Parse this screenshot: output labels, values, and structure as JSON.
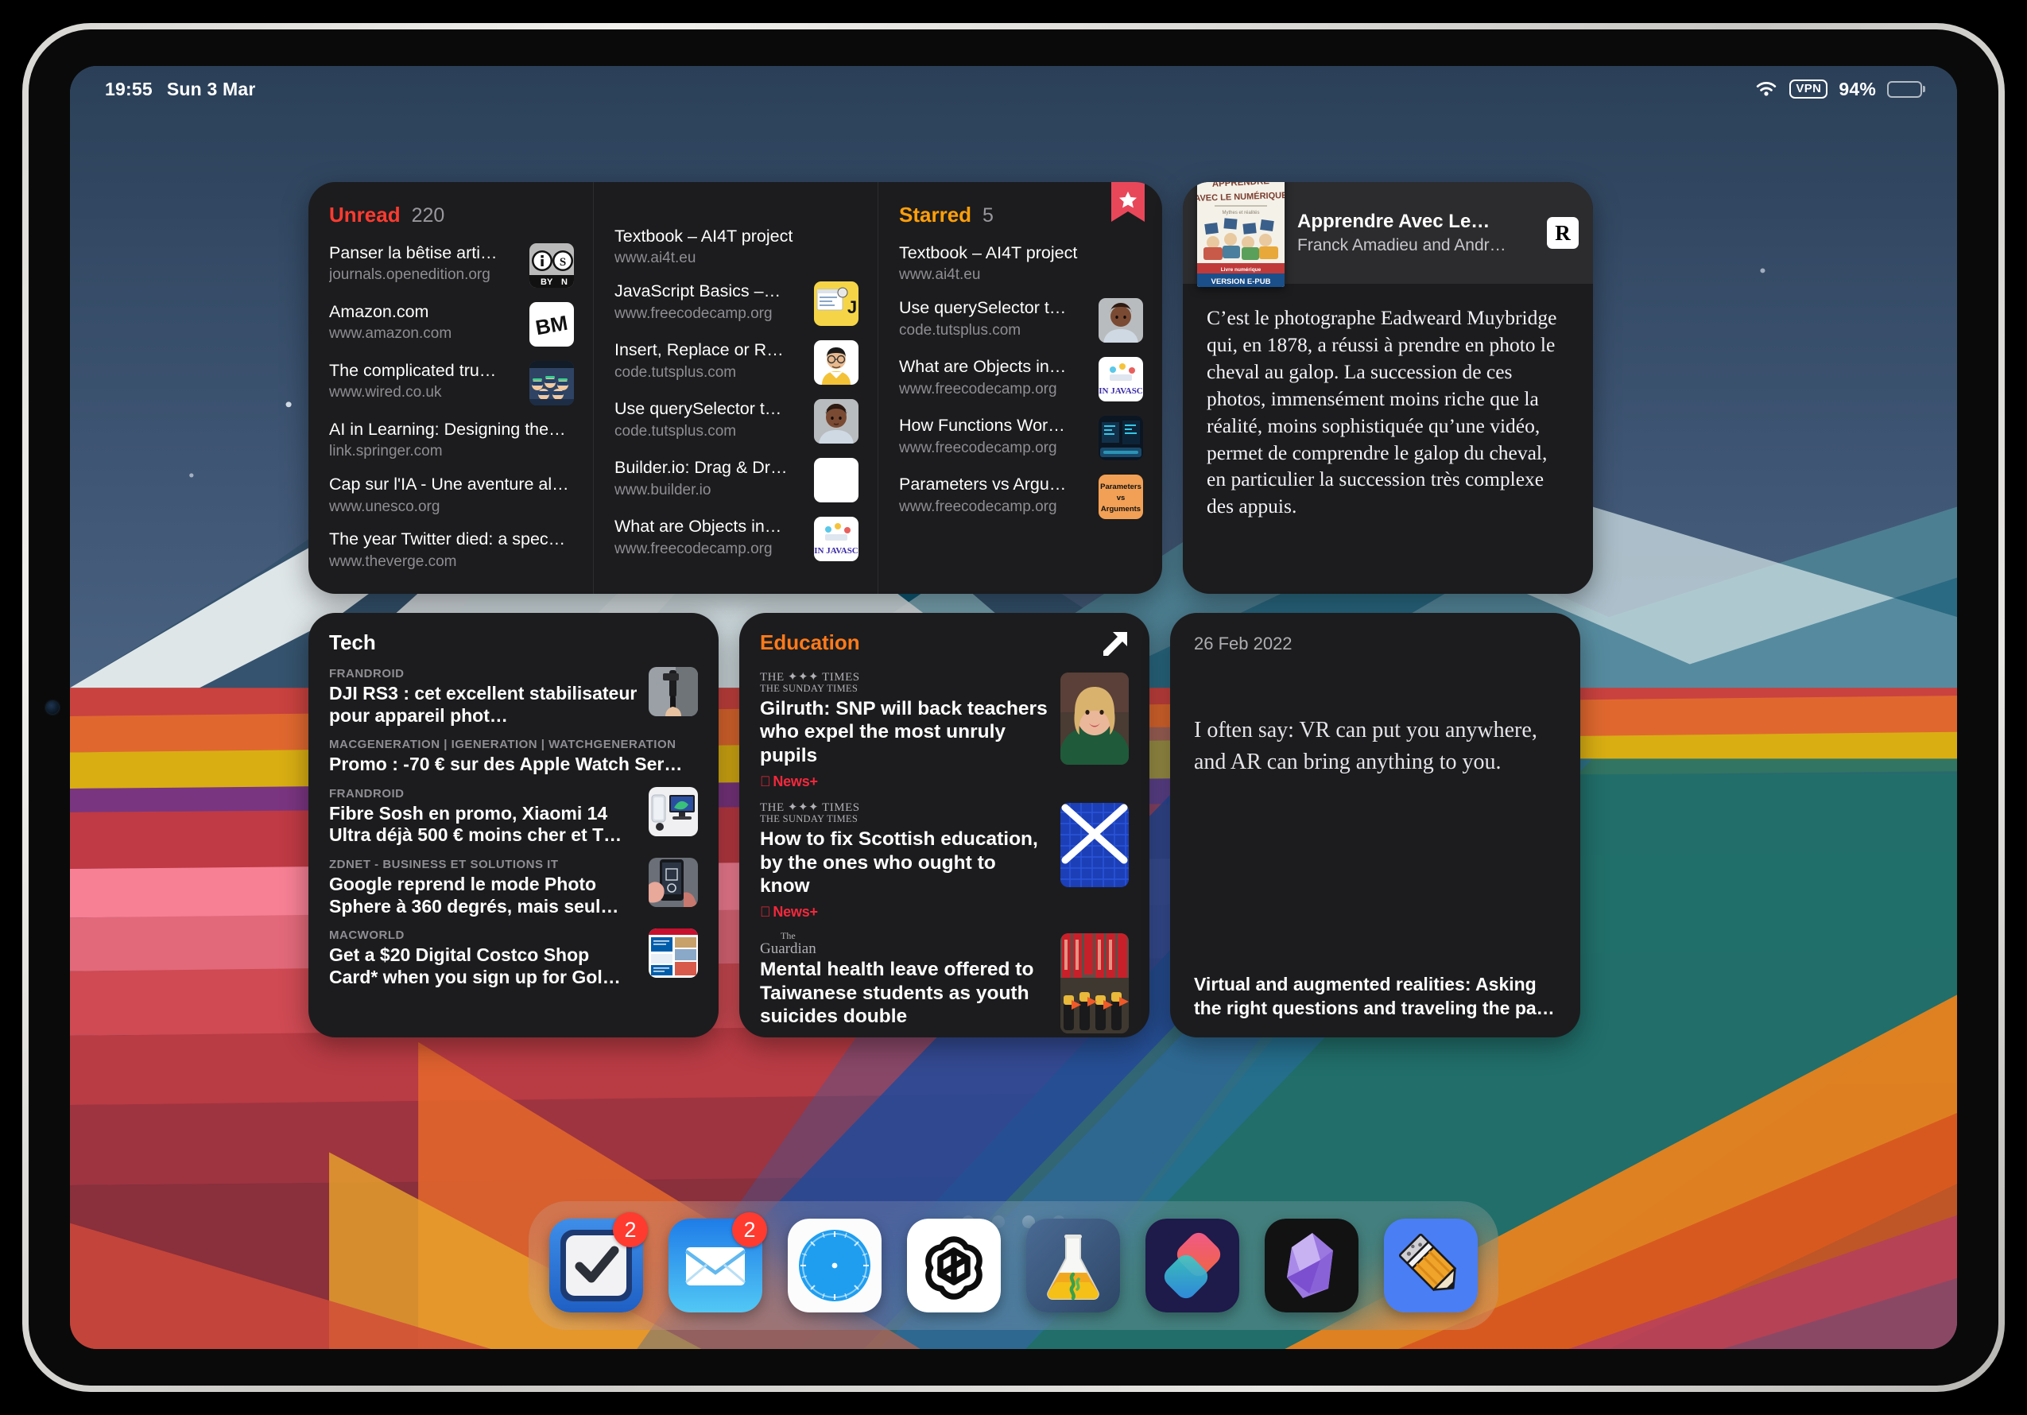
{
  "status_bar": {
    "time": "19:55",
    "date": "Sun 3 Mar",
    "wifi_icon": "wifi-icon",
    "vpn_label": "VPN",
    "battery_percent": "94%",
    "battery_level": 94
  },
  "unread_widget": {
    "title": "Unread",
    "count": "220",
    "items": [
      {
        "title": "Panser la bêtise arti…",
        "url": "journals.openedition.org",
        "thumb": "cc-by-nc-license-thumb"
      },
      {
        "title": "Amazon.com",
        "url": "www.amazon.com",
        "thumb": "ibm-logo-thumb"
      },
      {
        "title": "The complicated tru…",
        "url": "www.wired.co.uk",
        "thumb": "vr-crowd-illustration-thumb"
      },
      {
        "title": "AI in Learning: Designing the…",
        "url": "link.springer.com",
        "thumb": ""
      },
      {
        "title": "Cap sur l'IA - Une aventure al…",
        "url": "www.unesco.org",
        "thumb": ""
      },
      {
        "title": "The year Twitter died: a spec…",
        "url": "www.theverge.com",
        "thumb": ""
      }
    ]
  },
  "unread_widget_mid": {
    "items": [
      {
        "title": "Textbook – AI4T project",
        "url": "www.ai4t.eu",
        "thumb": ""
      },
      {
        "title": "JavaScript Basics –…",
        "url": "www.freecodecamp.org",
        "thumb": "js-yellow-thumb"
      },
      {
        "title": "Insert, Replace or R…",
        "url": "code.tutsplus.com",
        "thumb": "avatar-man-yellow-thumb"
      },
      {
        "title": "Use querySelector t…",
        "url": "code.tutsplus.com",
        "thumb": "avatar-woman-thumb"
      },
      {
        "title": "Builder.io: Drag & Dr…",
        "url": "www.builder.io",
        "thumb": "white-blank-thumb"
      },
      {
        "title": "What are Objects in…",
        "url": "www.freecodecamp.org",
        "thumb": "objects-in-javascript-thumb"
      }
    ]
  },
  "starred_widget": {
    "title": "Starred",
    "count": "5",
    "bookmark_icon": "starred-bookmark-icon",
    "items": [
      {
        "title": "Textbook – AI4T project",
        "url": "www.ai4t.eu",
        "thumb": ""
      },
      {
        "title": "Use querySelector t…",
        "url": "code.tutsplus.com",
        "thumb": "avatar-woman-thumb"
      },
      {
        "title": "What are Objects in…",
        "url": "www.freecodecamp.org",
        "thumb": "objects-in-javascript-thumb"
      },
      {
        "title": "How Functions Wor…",
        "url": "www.freecodecamp.org",
        "thumb": "code-screen-thumb"
      },
      {
        "title": "Parameters vs Argu…",
        "url": "www.freecodecamp.org",
        "thumb": "parameters-vs-arguments-thumb"
      }
    ]
  },
  "book_widget": {
    "app_logo": "readwise-logo",
    "app_logo_letter": "R",
    "cover_line1": "APPRENDRE",
    "cover_line2": "AVEC LE NUMÉRIQUE",
    "cover_sub": "Mythes et réalités",
    "cover_band1": "Livre numérique",
    "cover_band2": "VERSION E-PUB",
    "title": "Apprendre Avec Le…",
    "author": "Franck Amadieu and Andr…",
    "highlight": "C’est le photographe Eadweard Muybridge qui, en 1878, a réussi à prendre en photo le cheval au galop. La succession de ces photos, immensément moins riche que la réalité, moins sophistiquée qu’une vidéo, permet de comprendre le galop du cheval, en particulier la succession très complexe des appuis."
  },
  "tech_widget": {
    "title": "Tech",
    "items": [
      {
        "source": "FRANDROID",
        "title": "DJI RS3 : cet excellent stabilisateur pour appareil phot…",
        "thumb": "gimbal-photo-thumb"
      },
      {
        "source": "MACGENERATION | IGENERATION | WATCHGENERATION",
        "title": "Promo : -70 € sur des Apple Watch Ser…",
        "thumb": ""
      },
      {
        "source": "FRANDROID",
        "title": "Fibre Sosh en promo, Xiaomi 14 Ultra déjà 500 € moins cher et T…",
        "thumb": "phone-tv-thumb"
      },
      {
        "source": "ZDNET - BUSINESS ET SOLUTIONS IT",
        "title": "Google reprend le mode Photo Sphere à 360 degrés, mais seul…",
        "thumb": "hand-phone-camera-thumb"
      },
      {
        "source": "MACWORLD",
        "title": "Get a $20 Digital Costco Shop Card* when you sign up for Gol…",
        "thumb": "costco-offer-thumb"
      }
    ]
  },
  "education_widget": {
    "title": "Education",
    "app_icon": "apple-news-icon",
    "items": [
      {
        "publisher": "the-times-logo",
        "publisher_line1": "THE ✦✦✦ TIMES",
        "publisher_line2": "THE SUNDAY TIMES",
        "title": "Gilruth: SNP will back teachers who expel the most unruly pupils",
        "badge": "News+",
        "thumb": "woman-politician-thumb"
      },
      {
        "publisher": "the-times-logo",
        "publisher_line1": "THE ✦✦✦ TIMES",
        "publisher_line2": "THE SUNDAY TIMES",
        "title": "How to fix Scottish education, by the ones who ought to know",
        "badge": "News+",
        "thumb": "scotland-flag-thumb"
      },
      {
        "publisher": "the-guardian-logo",
        "publisher_line1": "The",
        "publisher_line2": "Guardian",
        "title": "Mental health leave offered to Taiwanese students as youth suicides double",
        "badge": "",
        "thumb": "taiwan-students-thumb"
      }
    ]
  },
  "quote_widget": {
    "date": "26 Feb 2022",
    "quote": "I often say: VR can put you anywhere, and AR can bring anything to you.",
    "caption": "Virtual and augmented realities: Asking the right questions and traveling the pa…"
  },
  "page_dots": {
    "total": 4,
    "active_index": 2
  },
  "dock": {
    "apps": [
      {
        "name": "Things",
        "icon": "things-checkmark-icon",
        "badge": "2"
      },
      {
        "name": "Mail",
        "icon": "mail-envelope-icon",
        "badge": "2"
      },
      {
        "name": "Safari",
        "icon": "safari-compass-icon",
        "badge": ""
      },
      {
        "name": "ChatGPT",
        "icon": "chatgpt-knot-icon",
        "badge": ""
      },
      {
        "name": "Scriptable",
        "icon": "flask-icon",
        "badge": ""
      },
      {
        "name": "Shortcuts",
        "icon": "shortcuts-icon",
        "badge": ""
      },
      {
        "name": "Obsidian",
        "icon": "obsidian-crystal-icon",
        "badge": ""
      },
      {
        "name": "Drafts",
        "icon": "pencil-icon",
        "badge": ""
      }
    ]
  },
  "colors": {
    "unread_red": "#ff3b30",
    "starred_orange": "#ff9f0a",
    "education_orange": "#ff7a1a",
    "news_plus_red": "#f5283c",
    "widget_bg": "#1c1c1e",
    "badge_red": "#ff3b30"
  }
}
